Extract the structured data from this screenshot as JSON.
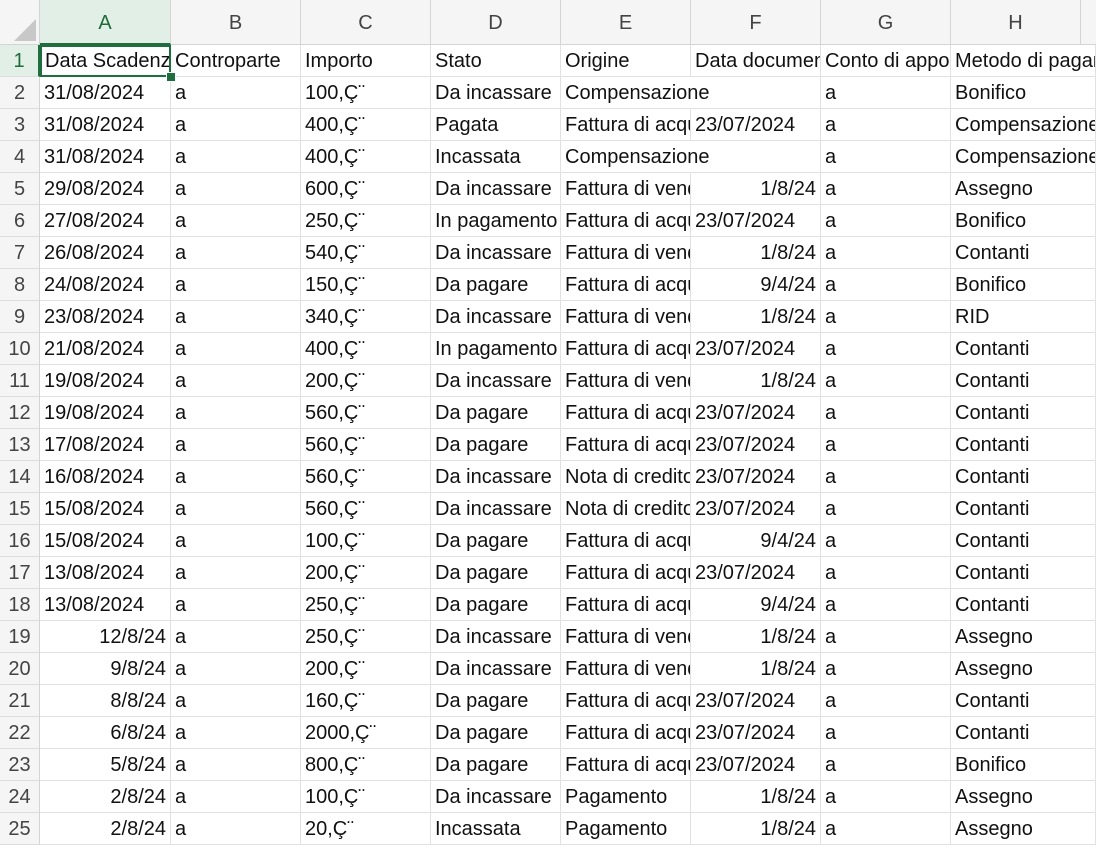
{
  "sheet": {
    "columns": [
      "A",
      "B",
      "C",
      "D",
      "E",
      "F",
      "G",
      "H"
    ],
    "active_column": "A",
    "active_row": 1,
    "rows": [
      {
        "n": "1",
        "cells": [
          "Data Scadenza",
          "Controparte",
          "Importo",
          "Stato",
          "Origine",
          "Data documento",
          "Conto di appoggio",
          "Metodo di pagamento"
        ]
      },
      {
        "n": "2",
        "cells": [
          "31/08/2024",
          "a",
          "100,Ç¨",
          "Da incassare",
          "Compensazione",
          "",
          "a",
          "Bonifico"
        ]
      },
      {
        "n": "3",
        "cells": [
          "31/08/2024",
          "a",
          "400,Ç¨",
          "Pagata",
          "Fattura di acquisto",
          "23/07/2024",
          "a",
          "Compensazione"
        ]
      },
      {
        "n": "4",
        "cells": [
          "31/08/2024",
          "a",
          "400,Ç¨",
          "Incassata",
          "Compensazione",
          "",
          "a",
          "Compensazione"
        ]
      },
      {
        "n": "5",
        "cells": [
          "29/08/2024",
          "a",
          "600,Ç¨",
          "Da incassare",
          "Fattura di vendita",
          "1/8/24",
          "a",
          "Assegno"
        ]
      },
      {
        "n": "6",
        "cells": [
          "27/08/2024",
          "a",
          "250,Ç¨",
          "In pagamento",
          "Fattura di acquisto",
          "23/07/2024",
          "a",
          "Bonifico"
        ]
      },
      {
        "n": "7",
        "cells": [
          "26/08/2024",
          "a",
          "540,Ç¨",
          "Da incassare",
          "Fattura di vendita",
          "1/8/24",
          "a",
          "Contanti"
        ]
      },
      {
        "n": "8",
        "cells": [
          "24/08/2024",
          "a",
          "150,Ç¨",
          "Da pagare",
          "Fattura di acquisto",
          "9/4/24",
          "a",
          "Bonifico"
        ]
      },
      {
        "n": "9",
        "cells": [
          "23/08/2024",
          "a",
          "340,Ç¨",
          "Da incassare",
          "Fattura di vendita",
          "1/8/24",
          "a",
          "RID"
        ]
      },
      {
        "n": "10",
        "cells": [
          "21/08/2024",
          "a",
          "400,Ç¨",
          "In pagamento",
          "Fattura di acquisto",
          "23/07/2024",
          "a",
          "Contanti"
        ]
      },
      {
        "n": "11",
        "cells": [
          "19/08/2024",
          "a",
          "200,Ç¨",
          "Da incassare",
          "Fattura di vendita",
          "1/8/24",
          "a",
          "Contanti"
        ]
      },
      {
        "n": "12",
        "cells": [
          "19/08/2024",
          "a",
          "560,Ç¨",
          "Da pagare",
          "Fattura di acquisto",
          "23/07/2024",
          "a",
          "Contanti"
        ]
      },
      {
        "n": "13",
        "cells": [
          "17/08/2024",
          "a",
          "560,Ç¨",
          "Da pagare",
          "Fattura di acquisto",
          "23/07/2024",
          "a",
          "Contanti"
        ]
      },
      {
        "n": "14",
        "cells": [
          "16/08/2024",
          "a",
          "560,Ç¨",
          "Da incassare",
          "Nota di credito",
          "23/07/2024",
          "a",
          "Contanti"
        ]
      },
      {
        "n": "15",
        "cells": [
          "15/08/2024",
          "a",
          "560,Ç¨",
          "Da incassare",
          "Nota di credito",
          "23/07/2024",
          "a",
          "Contanti"
        ]
      },
      {
        "n": "16",
        "cells": [
          "15/08/2024",
          "a",
          "100,Ç¨",
          "Da pagare",
          "Fattura di acquisto",
          "9/4/24",
          "a",
          "Contanti"
        ]
      },
      {
        "n": "17",
        "cells": [
          "13/08/2024",
          "a",
          "200,Ç¨",
          "Da pagare",
          "Fattura di acquisto",
          "23/07/2024",
          "a",
          "Contanti"
        ]
      },
      {
        "n": "18",
        "cells": [
          "13/08/2024",
          "a",
          "250,Ç¨",
          "Da pagare",
          "Fattura di acquisto",
          "9/4/24",
          "a",
          "Contanti"
        ]
      },
      {
        "n": "19",
        "cells": [
          "12/8/24",
          "a",
          "250,Ç¨",
          "Da incassare",
          "Fattura di vendita",
          "1/8/24",
          "a",
          "Assegno"
        ]
      },
      {
        "n": "20",
        "cells": [
          "9/8/24",
          "a",
          "200,Ç¨",
          "Da incassare",
          "Fattura di vendita",
          "1/8/24",
          "a",
          "Assegno"
        ]
      },
      {
        "n": "21",
        "cells": [
          "8/8/24",
          "a",
          "160,Ç¨",
          "Da pagare",
          "Fattura di acquisto",
          "23/07/2024",
          "a",
          "Contanti"
        ]
      },
      {
        "n": "22",
        "cells": [
          "6/8/24",
          "a",
          "2000,Ç¨",
          "Da pagare",
          "Fattura di acquisto",
          "23/07/2024",
          "a",
          "Contanti"
        ]
      },
      {
        "n": "23",
        "cells": [
          "5/8/24",
          "a",
          "800,Ç¨",
          "Da pagare",
          "Fattura di acquisto",
          "23/07/2024",
          "a",
          "Bonifico"
        ]
      },
      {
        "n": "24",
        "cells": [
          "2/8/24",
          "a",
          "100,Ç¨",
          "Da incassare",
          "Pagamento",
          "1/8/24",
          "a",
          "Assegno"
        ]
      },
      {
        "n": "25",
        "cells": [
          "2/8/24",
          "a",
          "20,Ç¨",
          "Incassata",
          "Pagamento",
          "1/8/24",
          "a",
          "Assegno"
        ]
      }
    ]
  }
}
